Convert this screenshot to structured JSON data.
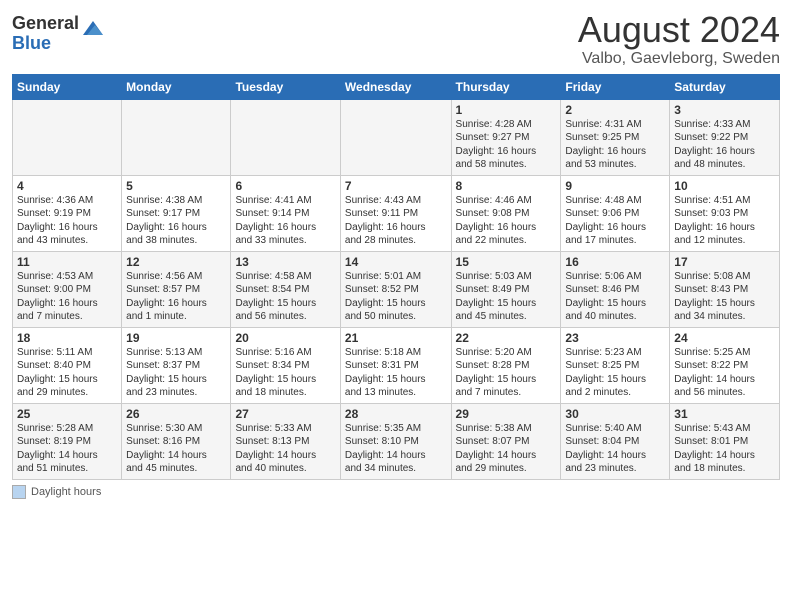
{
  "logo": {
    "general": "General",
    "blue": "Blue"
  },
  "title": "August 2024",
  "location": "Valbo, Gaevleborg, Sweden",
  "days_of_week": [
    "Sunday",
    "Monday",
    "Tuesday",
    "Wednesday",
    "Thursday",
    "Friday",
    "Saturday"
  ],
  "footer_label": "Daylight hours",
  "weeks": [
    [
      {
        "day": "",
        "info": ""
      },
      {
        "day": "",
        "info": ""
      },
      {
        "day": "",
        "info": ""
      },
      {
        "day": "",
        "info": ""
      },
      {
        "day": "1",
        "info": "Sunrise: 4:28 AM\nSunset: 9:27 PM\nDaylight: 16 hours\nand 58 minutes."
      },
      {
        "day": "2",
        "info": "Sunrise: 4:31 AM\nSunset: 9:25 PM\nDaylight: 16 hours\nand 53 minutes."
      },
      {
        "day": "3",
        "info": "Sunrise: 4:33 AM\nSunset: 9:22 PM\nDaylight: 16 hours\nand 48 minutes."
      }
    ],
    [
      {
        "day": "4",
        "info": "Sunrise: 4:36 AM\nSunset: 9:19 PM\nDaylight: 16 hours\nand 43 minutes."
      },
      {
        "day": "5",
        "info": "Sunrise: 4:38 AM\nSunset: 9:17 PM\nDaylight: 16 hours\nand 38 minutes."
      },
      {
        "day": "6",
        "info": "Sunrise: 4:41 AM\nSunset: 9:14 PM\nDaylight: 16 hours\nand 33 minutes."
      },
      {
        "day": "7",
        "info": "Sunrise: 4:43 AM\nSunset: 9:11 PM\nDaylight: 16 hours\nand 28 minutes."
      },
      {
        "day": "8",
        "info": "Sunrise: 4:46 AM\nSunset: 9:08 PM\nDaylight: 16 hours\nand 22 minutes."
      },
      {
        "day": "9",
        "info": "Sunrise: 4:48 AM\nSunset: 9:06 PM\nDaylight: 16 hours\nand 17 minutes."
      },
      {
        "day": "10",
        "info": "Sunrise: 4:51 AM\nSunset: 9:03 PM\nDaylight: 16 hours\nand 12 minutes."
      }
    ],
    [
      {
        "day": "11",
        "info": "Sunrise: 4:53 AM\nSunset: 9:00 PM\nDaylight: 16 hours\nand 7 minutes."
      },
      {
        "day": "12",
        "info": "Sunrise: 4:56 AM\nSunset: 8:57 PM\nDaylight: 16 hours\nand 1 minute."
      },
      {
        "day": "13",
        "info": "Sunrise: 4:58 AM\nSunset: 8:54 PM\nDaylight: 15 hours\nand 56 minutes."
      },
      {
        "day": "14",
        "info": "Sunrise: 5:01 AM\nSunset: 8:52 PM\nDaylight: 15 hours\nand 50 minutes."
      },
      {
        "day": "15",
        "info": "Sunrise: 5:03 AM\nSunset: 8:49 PM\nDaylight: 15 hours\nand 45 minutes."
      },
      {
        "day": "16",
        "info": "Sunrise: 5:06 AM\nSunset: 8:46 PM\nDaylight: 15 hours\nand 40 minutes."
      },
      {
        "day": "17",
        "info": "Sunrise: 5:08 AM\nSunset: 8:43 PM\nDaylight: 15 hours\nand 34 minutes."
      }
    ],
    [
      {
        "day": "18",
        "info": "Sunrise: 5:11 AM\nSunset: 8:40 PM\nDaylight: 15 hours\nand 29 minutes."
      },
      {
        "day": "19",
        "info": "Sunrise: 5:13 AM\nSunset: 8:37 PM\nDaylight: 15 hours\nand 23 minutes."
      },
      {
        "day": "20",
        "info": "Sunrise: 5:16 AM\nSunset: 8:34 PM\nDaylight: 15 hours\nand 18 minutes."
      },
      {
        "day": "21",
        "info": "Sunrise: 5:18 AM\nSunset: 8:31 PM\nDaylight: 15 hours\nand 13 minutes."
      },
      {
        "day": "22",
        "info": "Sunrise: 5:20 AM\nSunset: 8:28 PM\nDaylight: 15 hours\nand 7 minutes."
      },
      {
        "day": "23",
        "info": "Sunrise: 5:23 AM\nSunset: 8:25 PM\nDaylight: 15 hours\nand 2 minutes."
      },
      {
        "day": "24",
        "info": "Sunrise: 5:25 AM\nSunset: 8:22 PM\nDaylight: 14 hours\nand 56 minutes."
      }
    ],
    [
      {
        "day": "25",
        "info": "Sunrise: 5:28 AM\nSunset: 8:19 PM\nDaylight: 14 hours\nand 51 minutes."
      },
      {
        "day": "26",
        "info": "Sunrise: 5:30 AM\nSunset: 8:16 PM\nDaylight: 14 hours\nand 45 minutes."
      },
      {
        "day": "27",
        "info": "Sunrise: 5:33 AM\nSunset: 8:13 PM\nDaylight: 14 hours\nand 40 minutes."
      },
      {
        "day": "28",
        "info": "Sunrise: 5:35 AM\nSunset: 8:10 PM\nDaylight: 14 hours\nand 34 minutes."
      },
      {
        "day": "29",
        "info": "Sunrise: 5:38 AM\nSunset: 8:07 PM\nDaylight: 14 hours\nand 29 minutes."
      },
      {
        "day": "30",
        "info": "Sunrise: 5:40 AM\nSunset: 8:04 PM\nDaylight: 14 hours\nand 23 minutes."
      },
      {
        "day": "31",
        "info": "Sunrise: 5:43 AM\nSunset: 8:01 PM\nDaylight: 14 hours\nand 18 minutes."
      }
    ]
  ]
}
